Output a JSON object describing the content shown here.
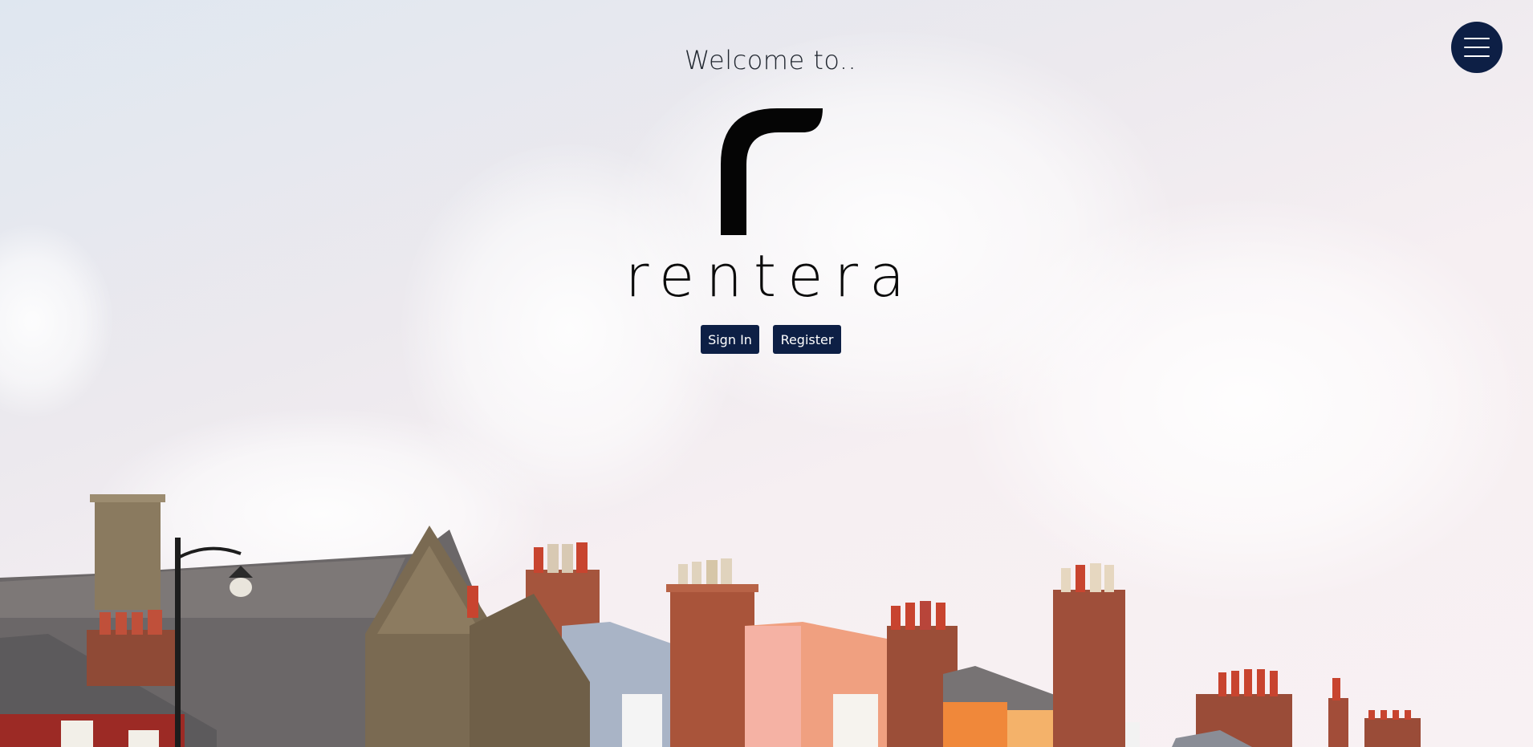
{
  "hero": {
    "welcome_text": "Welcome to..",
    "brand_name": "rentera"
  },
  "actions": {
    "sign_in_label": "Sign In",
    "register_label": "Register"
  },
  "menu": {
    "icon": "hamburger-menu-icon"
  },
  "colors": {
    "brand_navy": "#0d1f45",
    "text_dark": "#0b0b0b"
  }
}
